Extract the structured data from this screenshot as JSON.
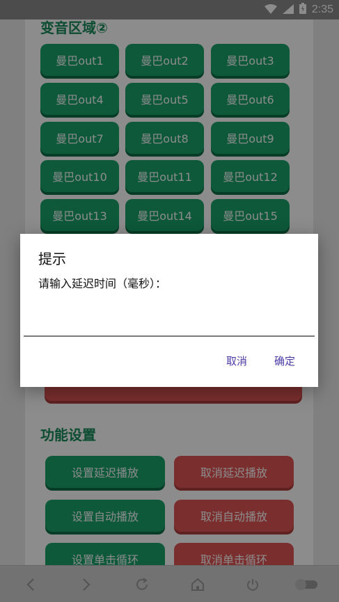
{
  "status_bar": {
    "time": "2:35",
    "icons": [
      "wifi-icon",
      "signal-icon",
      "battery-icon"
    ]
  },
  "section1": {
    "title": "变音区域②",
    "buttons": [
      "曼巴out1",
      "曼巴out2",
      "曼巴out3",
      "曼巴out4",
      "曼巴out5",
      "曼巴out6",
      "曼巴out7",
      "曼巴out8",
      "曼巴out9",
      "曼巴out10",
      "曼巴out11",
      "曼巴out12",
      "曼巴out13",
      "曼巴out14",
      "曼巴out15"
    ]
  },
  "section2": {
    "title": "功能设置",
    "buttons": [
      {
        "label": "设置延迟播放",
        "color": "green"
      },
      {
        "label": "取消延迟播放",
        "color": "red"
      },
      {
        "label": "设置自动播放",
        "color": "green"
      },
      {
        "label": "取消自动播放",
        "color": "red"
      },
      {
        "label": "设置单击循环",
        "color": "green"
      },
      {
        "label": "取消单击循环",
        "color": "red"
      }
    ]
  },
  "dialog": {
    "title": "提示",
    "message": "请输入延迟时间（毫秒）：",
    "input_value": "",
    "cancel_label": "取消",
    "confirm_label": "确定"
  },
  "bottom_nav": {
    "icons": [
      "back-icon",
      "forward-icon",
      "refresh-icon",
      "home-icon",
      "power-icon",
      "toggle-icon"
    ]
  },
  "colors": {
    "green": "#18a26a",
    "red": "#e05555",
    "title_green": "#178a5a",
    "dialog_button": "#4a3aa8"
  }
}
